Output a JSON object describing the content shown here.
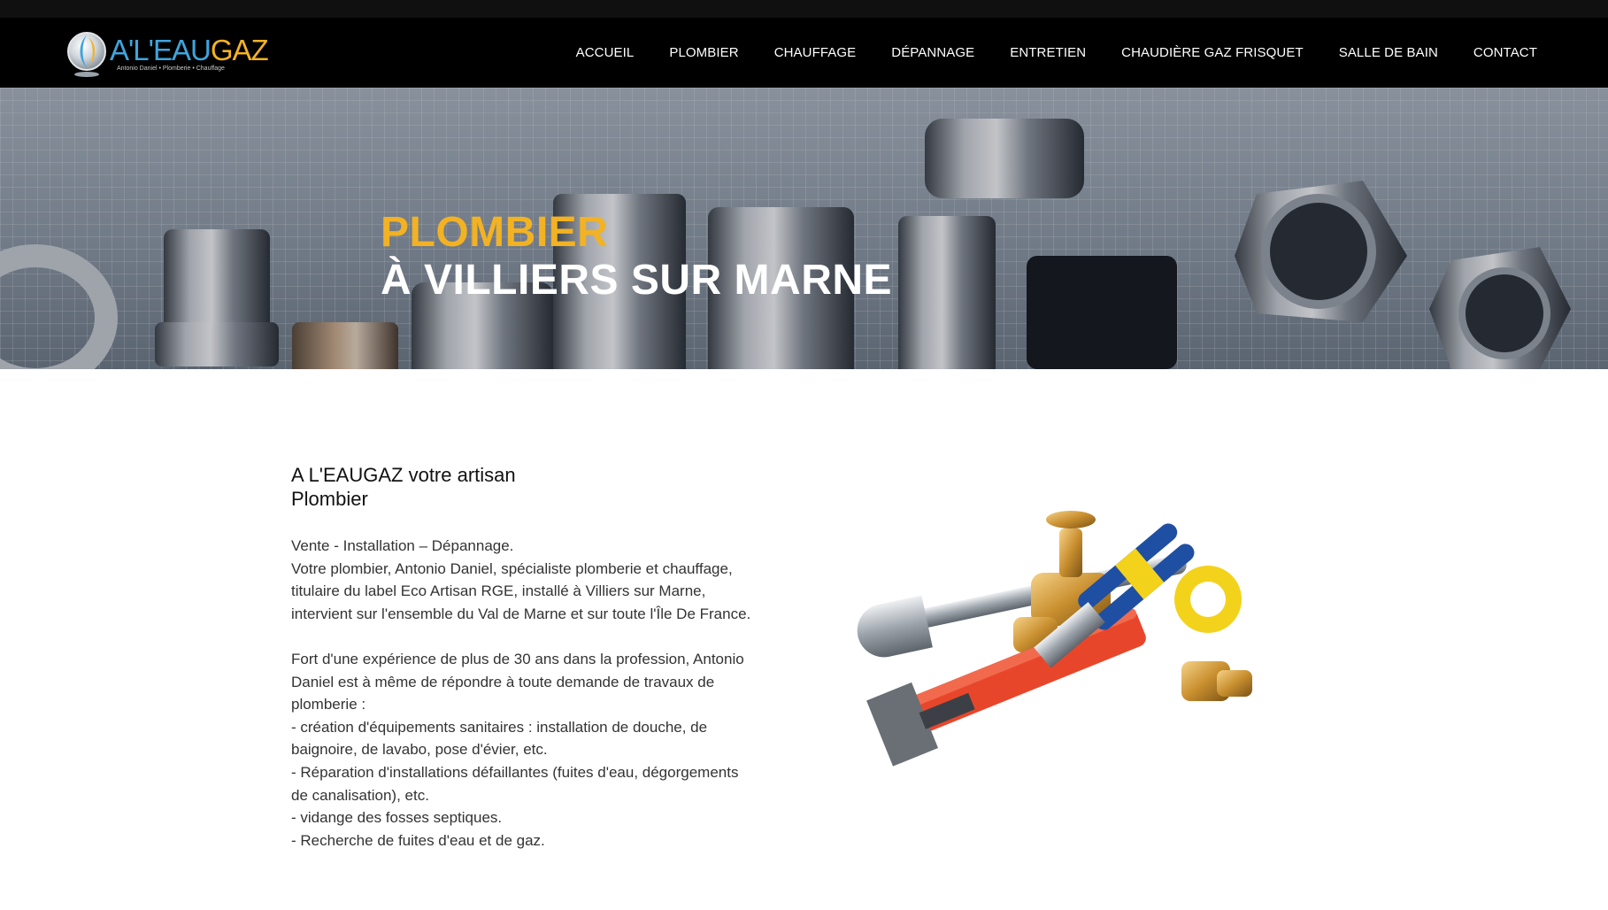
{
  "brand": {
    "logo_part1": "A'L'EAU",
    "logo_part2": "GAZ",
    "logo_tagline": "Antonio Daniel • Plomberie • Chauffage",
    "colors": {
      "blue": "#3fa4dc",
      "gold": "#f2b223",
      "nav_bg": "#000000"
    }
  },
  "nav": {
    "items": [
      {
        "label": "ACCUEIL"
      },
      {
        "label": "PLOMBIER"
      },
      {
        "label": "CHAUFFAGE"
      },
      {
        "label": "DÉPANNAGE"
      },
      {
        "label": "ENTRETIEN"
      },
      {
        "label": "CHAUDIÈRE GAZ FRISQUET"
      },
      {
        "label": "SALLE DE BAIN"
      },
      {
        "label": "CONTACT"
      }
    ]
  },
  "hero": {
    "title": "PLOMBIER",
    "subtitle": "À VILLIERS SUR MARNE",
    "title_color": "#f2b223"
  },
  "intro": {
    "heading_line1": "A L'EAUGAZ votre artisan",
    "heading_line2": "Plombier",
    "lines": [
      "Vente - Installation – Dépannage.",
      "Votre plombier, Antonio Daniel, spécialiste plomberie et chauffage,",
      "titulaire du label Eco Artisan RGE, installé à Villiers sur Marne,",
      "intervient sur l'ensemble du Val de Marne et sur toute l'Île De France.",
      "",
      "Fort d'une expérience de plus de 30 ans dans la profession, Antonio",
      "Daniel est à même de répondre à toute demande de travaux de",
      "plomberie :",
      "- création d'équipements sanitaires : installation de douche, de",
      "baignoire, de lavabo, pose d'évier, etc.",
      "- Réparation d'installations défaillantes (fuites d'eau, dégorgements",
      "de canalisation), etc.",
      "- vidange des fosses septiques.",
      "- Recherche de fuites d'eau et de gaz."
    ]
  }
}
